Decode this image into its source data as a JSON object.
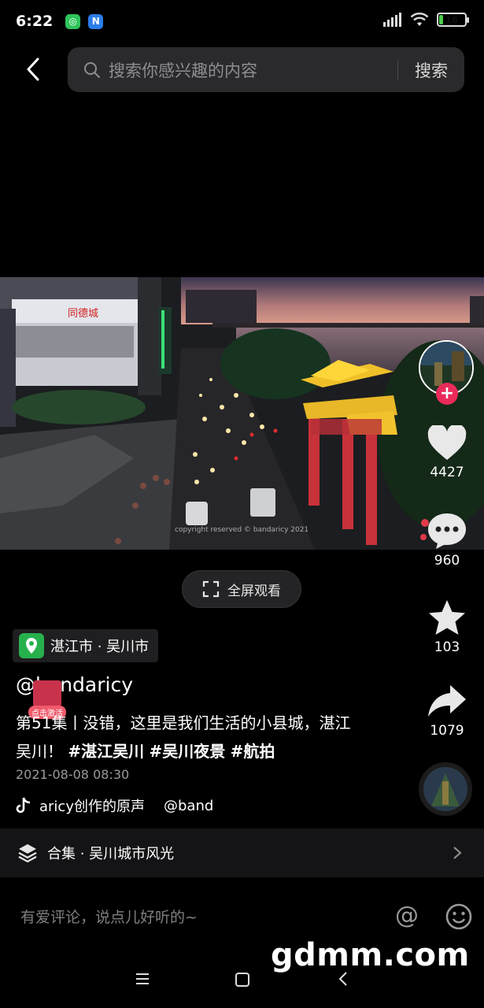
{
  "status_bar": {
    "time": "6:22",
    "app_badge_1": "◎",
    "app_badge_2": "N",
    "battery_level": "16",
    "battery_fraction": 0.16
  },
  "search": {
    "placeholder": "搜索你感兴趣的内容",
    "button_label": "搜索"
  },
  "video": {
    "watermark": "copyright reserved © bandaricy 2021",
    "sign_text": "同德城"
  },
  "fullscreen": {
    "label": "全屏观看"
  },
  "actions": {
    "likes": "4427",
    "comments": "960",
    "favorites": "103",
    "shares": "1079"
  },
  "location": {
    "label": "湛江市 · 吴川市"
  },
  "post": {
    "author": "@bandaricy",
    "activate_label": "点击激活",
    "caption_prefix": "第51集丨没错，这里是我们生活的小县城，湛江吴川！",
    "tags": [
      "#湛江吴川",
      "#吴川夜景",
      "#航拍"
    ],
    "time": "2021-08-08 08:30"
  },
  "music": {
    "title": "aricy创作的原声",
    "mention": "@band"
  },
  "collection": {
    "label": "合集 · 吴川城市风光"
  },
  "comment": {
    "placeholder": "有爱评论，说点儿好听的~",
    "at_symbol": "@"
  },
  "overlay": {
    "site_watermark": "gdmm.com"
  },
  "colors": {
    "accent_red": "#ea2b5a",
    "location_green": "#27b14d",
    "background": "#000000"
  }
}
